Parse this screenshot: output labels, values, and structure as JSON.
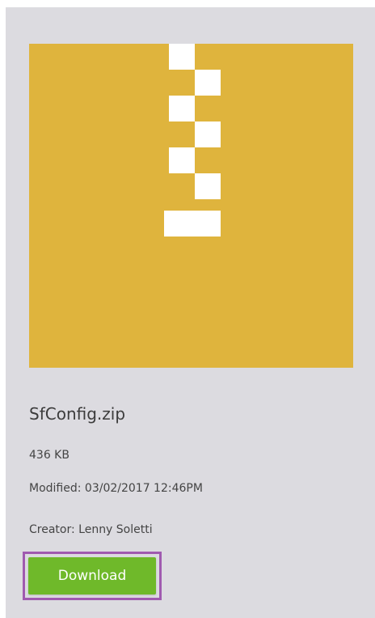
{
  "file": {
    "name": "SfConfig.zip",
    "size": "436 KB",
    "modified": "Modified: 03/02/2017 12:46PM",
    "creator": "Creator: Lenny Soletti",
    "icon": "zip-archive-icon",
    "icon_color": "#dfb43d"
  },
  "actions": {
    "download_label": "Download",
    "download_color": "#6fb92a",
    "highlight_color": "#a05ab0"
  }
}
